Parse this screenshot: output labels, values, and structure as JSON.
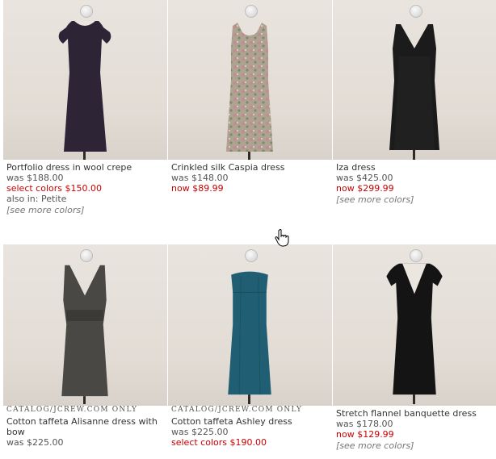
{
  "products": [
    {
      "name": "Portfolio dress in wool crepe",
      "was": "was $188.00",
      "sale": "select colors $150.00",
      "also": "also in: Petite",
      "more": "[see more colors]",
      "catalog": "",
      "color": "#2d2436"
    },
    {
      "name": "Crinkled silk Caspia dress",
      "was": "was $148.00",
      "sale": "now $89.99",
      "also": "",
      "more": "",
      "catalog": "",
      "color": "#a9a08e"
    },
    {
      "name": "Iza dress",
      "was": "was $425.00",
      "sale": "now $299.99",
      "also": "",
      "more": "[see more colors]",
      "catalog": "",
      "color": "#1c1b1c"
    },
    {
      "name": "Cotton taffeta Alisanne dress with bow",
      "was": "was $225.00",
      "sale": "",
      "also": "",
      "more": "",
      "catalog": "CATALOG/JCREW.COM ONLY",
      "color": "#4a4844"
    },
    {
      "name": "Cotton taffeta Ashley dress",
      "was": "was $225.00",
      "sale": "select colors $190.00",
      "also": "",
      "more": "",
      "catalog": "CATALOG/JCREW.COM ONLY",
      "color": "#1f5e73"
    },
    {
      "name": "Stretch flannel banquette dress",
      "was": "was $178.00",
      "sale": "now $129.99",
      "also": "",
      "more": "[see more colors]",
      "catalog": "",
      "color": "#141414"
    }
  ],
  "colors": {
    "sale": "#cc0000",
    "background": "#e6e0d9"
  },
  "cursor": "hand-pointer-icon"
}
